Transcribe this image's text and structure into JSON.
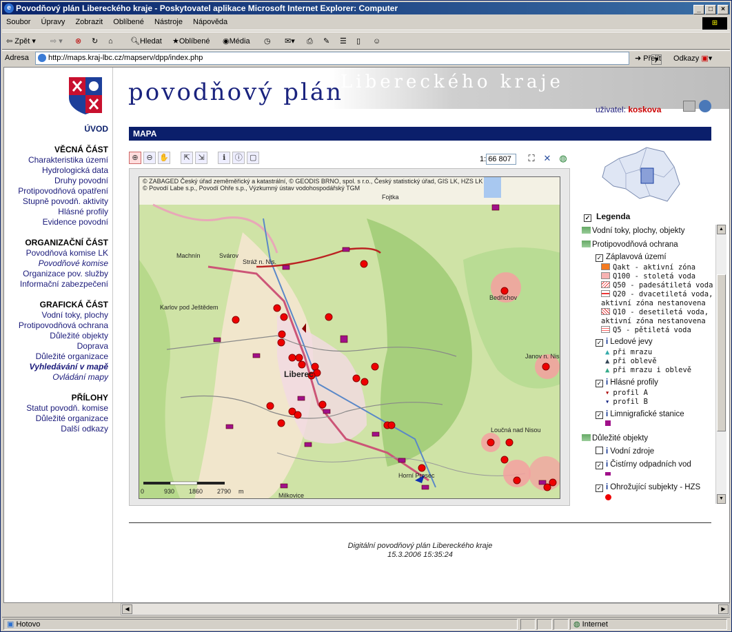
{
  "window": {
    "title": "Povodňový plán Libereckého kraje - Poskytovatel aplikace Microsoft Internet Explorer: Computer"
  },
  "menu": [
    "Soubor",
    "Úpravy",
    "Zobrazit",
    "Oblíbené",
    "Nástroje",
    "Nápověda"
  ],
  "toolbar": {
    "back": "Zpět",
    "search": "Hledat",
    "favorites": "Oblíbené",
    "media": "Média"
  },
  "address": {
    "label": "Adresa",
    "url": "http://maps.kraj-lbc.cz/mapserv/dpp/index.php",
    "go": "Přejít",
    "links": "Odkazy"
  },
  "banner": {
    "title": "povodňový plán",
    "subtitle": "Libereckého kraje"
  },
  "user": {
    "label": "uživatel:",
    "name": "koskova"
  },
  "sidebar": {
    "home": "ÚVOD",
    "sections": [
      {
        "title": "VĚCNÁ ČÁST",
        "items": [
          "Charakteristika území",
          "Hydrologická data",
          "Druhy povodní",
          "Protipovodňová opatření",
          "Stupně povodň. aktivity",
          "Hlásné profily",
          "Evidence povodní"
        ]
      },
      {
        "title": "ORGANIZAČNÍ ČÁST",
        "items": [
          "Povodňová komise LK",
          "Povodňové komise",
          "Organizace pov. služby",
          "Informační zabezpečení"
        ]
      },
      {
        "title": "GRAFICKÁ ČÁST",
        "items": [
          "Vodní toky, plochy",
          "Protipovodňová ochrana",
          "Důležité objekty",
          "Doprava",
          "Důležité organizace",
          "Vyhledávání v mapě",
          "Ovládání mapy"
        ]
      },
      {
        "title": "PŘÍLOHY",
        "items": [
          "Statut povodň. komise",
          "Důležité organizace",
          "Další odkazy"
        ]
      }
    ]
  },
  "map": {
    "header": "MAPA",
    "scale_prefix": "1:",
    "scale_value": "66 807",
    "copyright1": "© ZABAGED Český úřad zeměměřický a katastrální, © GEODIS BRNO, spol. s r.o., Český statistický úřad, GIS LK, HZS LK",
    "copyright2": "© Povodí Labe s.p., Povodí Ohře s.p., Výzkumný ústav vodohospodářský TGM",
    "places": [
      "Fojtka",
      "Machnín",
      "Svárov",
      "Stráž n. Nis.",
      "Karlov pod Ještědem",
      "Bedřichov",
      "Liberec",
      "Janov n. Nis",
      "Loučná nad Nisou",
      "Horní Prosec",
      "Milkovice"
    ],
    "scalebar": [
      "0",
      "930",
      "1860",
      "2790",
      "m"
    ]
  },
  "legend": {
    "title": "Legenda",
    "rows": [
      {
        "label": "Vodní toky, plochy, objekty"
      },
      {
        "label": "Protipovodňová ochrana"
      },
      {
        "label": "Záplavová území"
      },
      {
        "label": "Qakt - aktivní zóna",
        "color": "#f47a20"
      },
      {
        "label": "Q100 - stoletá voda",
        "color": "#f7b2b2"
      },
      {
        "label": "Q50 - padesátiletá voda",
        "color": "#f06060"
      },
      {
        "label": "Q20 - dvacetiletá voda,",
        "label2": "aktivní zóna nestanovena",
        "color": "#e33"
      },
      {
        "label": "Q10 - desetiletá voda,",
        "label2": "aktivní zóna nestanovena",
        "color": "#d22"
      },
      {
        "label": "Q5 - pětiletá voda",
        "color": "#f66"
      },
      {
        "label": "Ledové jevy"
      },
      {
        "label": "při mrazu"
      },
      {
        "label": "při oblevě"
      },
      {
        "label": "při mrazu i oblevě"
      },
      {
        "label": "Hlásné profily"
      },
      {
        "label": "profil A"
      },
      {
        "label": "profil B"
      },
      {
        "label": "Limnigrafické stanice"
      },
      {
        "label": "Důležité objekty"
      },
      {
        "label": "Vodní zdroje"
      },
      {
        "label": "Čistírny odpadních vod"
      },
      {
        "label": "Ohrožující subjekty - HZS"
      }
    ]
  },
  "footer": {
    "line1": "Digitální povodňový plán Libereckého kraje",
    "line2": "15.3.2006 15:35:24"
  },
  "status": {
    "left": "Hotovo",
    "zone": "Internet"
  }
}
